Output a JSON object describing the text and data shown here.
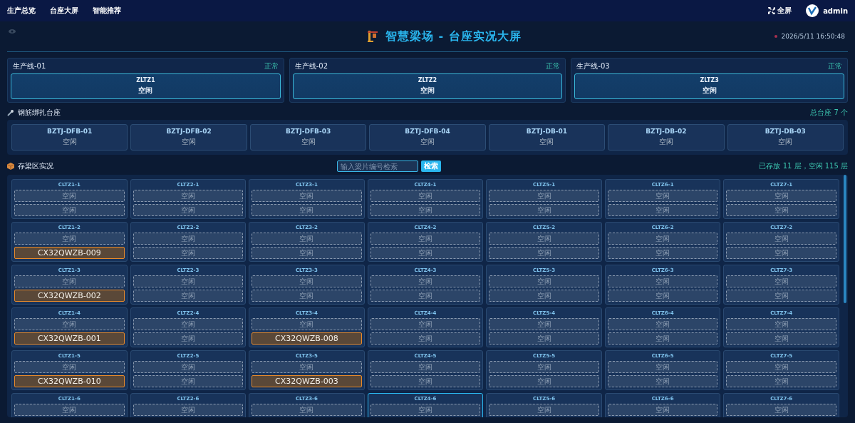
{
  "nav": {
    "items": [
      {
        "label": "生产总览"
      },
      {
        "label": "台座大屏"
      },
      {
        "label": "智能推荐"
      }
    ],
    "fullscreen": "全屏",
    "user": "admin"
  },
  "header": {
    "title": "智慧梁场 - 台座实况大屏",
    "time": "2026/5/11 16:50:48"
  },
  "lines": [
    {
      "name": "生产线-01",
      "status": "正常",
      "pedestal": {
        "code": "ZLTZ1",
        "state": "空闲"
      }
    },
    {
      "name": "生产线-02",
      "status": "正常",
      "pedestal": {
        "code": "ZLTZ2",
        "state": "空闲"
      }
    },
    {
      "name": "生产线-03",
      "status": "正常",
      "pedestal": {
        "code": "ZLTZ3",
        "state": "空闲"
      }
    }
  ],
  "binding": {
    "title": "钢筋绑扎台座",
    "total": "总台座 7 个",
    "pedestals": [
      {
        "code": "BZTJ-DFB-01",
        "state": "空闲"
      },
      {
        "code": "BZTJ-DFB-02",
        "state": "空闲"
      },
      {
        "code": "BZTJ-DFB-03",
        "state": "空闲"
      },
      {
        "code": "BZTJ-DFB-04",
        "state": "空闲"
      },
      {
        "code": "BZTJ-DB-01",
        "state": "空闲"
      },
      {
        "code": "BZTJ-DB-02",
        "state": "空闲"
      },
      {
        "code": "BZTJ-DB-03",
        "state": "空闲"
      }
    ]
  },
  "storage": {
    "title": "存梁区实况",
    "search": {
      "placeholder": "输入梁片编号检索",
      "button": "检索"
    },
    "summary": "已存放 11 层，空闲 115 层",
    "cells": [
      {
        "name": "CLTZ1-1",
        "selected": false,
        "layers": [
          {
            "occupied": false,
            "label": "空闲"
          },
          {
            "occupied": false,
            "label": "空闲"
          }
        ]
      },
      {
        "name": "CLTZ2-1",
        "selected": false,
        "layers": [
          {
            "occupied": false,
            "label": "空闲"
          },
          {
            "occupied": false,
            "label": "空闲"
          }
        ]
      },
      {
        "name": "CLTZ3-1",
        "selected": false,
        "layers": [
          {
            "occupied": false,
            "label": "空闲"
          },
          {
            "occupied": false,
            "label": "空闲"
          }
        ]
      },
      {
        "name": "CLTZ4-1",
        "selected": false,
        "layers": [
          {
            "occupied": false,
            "label": "空闲"
          },
          {
            "occupied": false,
            "label": "空闲"
          }
        ]
      },
      {
        "name": "CLTZ5-1",
        "selected": false,
        "layers": [
          {
            "occupied": false,
            "label": "空闲"
          },
          {
            "occupied": false,
            "label": "空闲"
          }
        ]
      },
      {
        "name": "CLTZ6-1",
        "selected": false,
        "layers": [
          {
            "occupied": false,
            "label": "空闲"
          },
          {
            "occupied": false,
            "label": "空闲"
          }
        ]
      },
      {
        "name": "CLTZ7-1",
        "selected": false,
        "layers": [
          {
            "occupied": false,
            "label": "空闲"
          },
          {
            "occupied": false,
            "label": "空闲"
          }
        ]
      },
      {
        "name": "CLTZ1-2",
        "selected": false,
        "layers": [
          {
            "occupied": false,
            "label": "空闲"
          },
          {
            "occupied": true,
            "label": "CX32QWZB-009"
          }
        ]
      },
      {
        "name": "CLTZ2-2",
        "selected": false,
        "layers": [
          {
            "occupied": false,
            "label": "空闲"
          },
          {
            "occupied": false,
            "label": "空闲"
          }
        ]
      },
      {
        "name": "CLTZ3-2",
        "selected": false,
        "layers": [
          {
            "occupied": false,
            "label": "空闲"
          },
          {
            "occupied": false,
            "label": "空闲"
          }
        ]
      },
      {
        "name": "CLTZ4-2",
        "selected": false,
        "layers": [
          {
            "occupied": false,
            "label": "空闲"
          },
          {
            "occupied": false,
            "label": "空闲"
          }
        ]
      },
      {
        "name": "CLTZ5-2",
        "selected": false,
        "layers": [
          {
            "occupied": false,
            "label": "空闲"
          },
          {
            "occupied": false,
            "label": "空闲"
          }
        ]
      },
      {
        "name": "CLTZ6-2",
        "selected": false,
        "layers": [
          {
            "occupied": false,
            "label": "空闲"
          },
          {
            "occupied": false,
            "label": "空闲"
          }
        ]
      },
      {
        "name": "CLTZ7-2",
        "selected": false,
        "layers": [
          {
            "occupied": false,
            "label": "空闲"
          },
          {
            "occupied": false,
            "label": "空闲"
          }
        ]
      },
      {
        "name": "CLTZ1-3",
        "selected": false,
        "layers": [
          {
            "occupied": false,
            "label": "空闲"
          },
          {
            "occupied": true,
            "label": "CX32QWZB-002"
          }
        ]
      },
      {
        "name": "CLTZ2-3",
        "selected": false,
        "layers": [
          {
            "occupied": false,
            "label": "空闲"
          },
          {
            "occupied": false,
            "label": "空闲"
          }
        ]
      },
      {
        "name": "CLTZ3-3",
        "selected": false,
        "layers": [
          {
            "occupied": false,
            "label": "空闲"
          },
          {
            "occupied": false,
            "label": "空闲"
          }
        ]
      },
      {
        "name": "CLTZ4-3",
        "selected": false,
        "layers": [
          {
            "occupied": false,
            "label": "空闲"
          },
          {
            "occupied": false,
            "label": "空闲"
          }
        ]
      },
      {
        "name": "CLTZ5-3",
        "selected": false,
        "layers": [
          {
            "occupied": false,
            "label": "空闲"
          },
          {
            "occupied": false,
            "label": "空闲"
          }
        ]
      },
      {
        "name": "CLTZ6-3",
        "selected": false,
        "layers": [
          {
            "occupied": false,
            "label": "空闲"
          },
          {
            "occupied": false,
            "label": "空闲"
          }
        ]
      },
      {
        "name": "CLTZ7-3",
        "selected": false,
        "layers": [
          {
            "occupied": false,
            "label": "空闲"
          },
          {
            "occupied": false,
            "label": "空闲"
          }
        ]
      },
      {
        "name": "CLTZ1-4",
        "selected": false,
        "layers": [
          {
            "occupied": false,
            "label": "空闲"
          },
          {
            "occupied": true,
            "label": "CX32QWZB-001"
          }
        ]
      },
      {
        "name": "CLTZ2-4",
        "selected": false,
        "layers": [
          {
            "occupied": false,
            "label": "空闲"
          },
          {
            "occupied": false,
            "label": "空闲"
          }
        ]
      },
      {
        "name": "CLTZ3-4",
        "selected": false,
        "layers": [
          {
            "occupied": false,
            "label": "空闲"
          },
          {
            "occupied": true,
            "label": "CX32QWZB-008"
          }
        ]
      },
      {
        "name": "CLTZ4-4",
        "selected": false,
        "layers": [
          {
            "occupied": false,
            "label": "空闲"
          },
          {
            "occupied": false,
            "label": "空闲"
          }
        ]
      },
      {
        "name": "CLTZ5-4",
        "selected": false,
        "layers": [
          {
            "occupied": false,
            "label": "空闲"
          },
          {
            "occupied": false,
            "label": "空闲"
          }
        ]
      },
      {
        "name": "CLTZ6-4",
        "selected": false,
        "layers": [
          {
            "occupied": false,
            "label": "空闲"
          },
          {
            "occupied": false,
            "label": "空闲"
          }
        ]
      },
      {
        "name": "CLTZ7-4",
        "selected": false,
        "layers": [
          {
            "occupied": false,
            "label": "空闲"
          },
          {
            "occupied": false,
            "label": "空闲"
          }
        ]
      },
      {
        "name": "CLTZ1-5",
        "selected": false,
        "layers": [
          {
            "occupied": false,
            "label": "空闲"
          },
          {
            "occupied": true,
            "label": "CX32QWZB-010"
          }
        ]
      },
      {
        "name": "CLTZ2-5",
        "selected": false,
        "layers": [
          {
            "occupied": false,
            "label": "空闲"
          },
          {
            "occupied": false,
            "label": "空闲"
          }
        ]
      },
      {
        "name": "CLTZ3-5",
        "selected": false,
        "layers": [
          {
            "occupied": false,
            "label": "空闲"
          },
          {
            "occupied": true,
            "label": "CX32QWZB-003"
          }
        ]
      },
      {
        "name": "CLTZ4-5",
        "selected": false,
        "layers": [
          {
            "occupied": false,
            "label": "空闲"
          },
          {
            "occupied": false,
            "label": "空闲"
          }
        ]
      },
      {
        "name": "CLTZ5-5",
        "selected": false,
        "layers": [
          {
            "occupied": false,
            "label": "空闲"
          },
          {
            "occupied": false,
            "label": "空闲"
          }
        ]
      },
      {
        "name": "CLTZ6-5",
        "selected": false,
        "layers": [
          {
            "occupied": false,
            "label": "空闲"
          },
          {
            "occupied": false,
            "label": "空闲"
          }
        ]
      },
      {
        "name": "CLTZ7-5",
        "selected": false,
        "layers": [
          {
            "occupied": false,
            "label": "空闲"
          },
          {
            "occupied": false,
            "label": "空闲"
          }
        ]
      },
      {
        "name": "CLTZ1-6",
        "selected": false,
        "layers": [
          {
            "occupied": false,
            "label": "空闲"
          }
        ]
      },
      {
        "name": "CLTZ2-6",
        "selected": false,
        "layers": [
          {
            "occupied": false,
            "label": "空闲"
          }
        ]
      },
      {
        "name": "CLTZ3-6",
        "selected": false,
        "layers": [
          {
            "occupied": false,
            "label": "空闲"
          }
        ]
      },
      {
        "name": "CLTZ4-6",
        "selected": true,
        "layers": [
          {
            "occupied": false,
            "label": "空闲"
          }
        ]
      },
      {
        "name": "CLTZ5-6",
        "selected": false,
        "layers": [
          {
            "occupied": false,
            "label": "空闲"
          }
        ]
      },
      {
        "name": "CLTZ6-6",
        "selected": false,
        "layers": [
          {
            "occupied": false,
            "label": "空闲"
          }
        ]
      },
      {
        "name": "CLTZ7-6",
        "selected": false,
        "layers": [
          {
            "occupied": false,
            "label": "空闲"
          }
        ]
      }
    ]
  }
}
